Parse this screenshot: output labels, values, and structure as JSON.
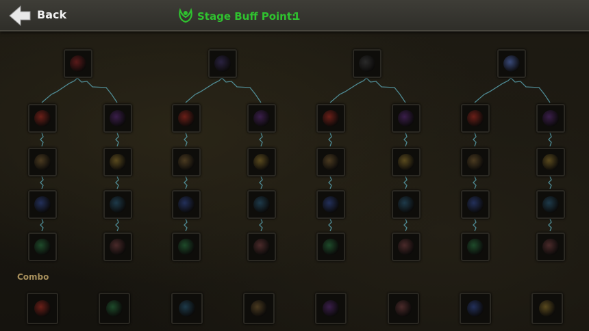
{
  "header": {
    "back_label": "Back",
    "buff_label": "Stage Buff Point:",
    "buff_value": "1",
    "buff_color": "#2fc22f"
  },
  "tree": {
    "columns": [
      {
        "root": {
          "icon": "demon-mask-icon",
          "color": "#5a1a1a"
        },
        "branches": [
          [
            "flame-orb-icon",
            "swirl-icon",
            "potion-icon",
            "red-rune-icon"
          ],
          [
            "claw-icon",
            "fire-fist-icon",
            "shadow-wing-icon",
            "dragon-head-icon"
          ]
        ]
      },
      {
        "root": {
          "icon": "void-orb-icon",
          "color": "#2a2240"
        },
        "branches": [
          [
            "blue-vortex-icon",
            "ice-slash-icon",
            "dark-knight-icon",
            "spear-bolt-icon"
          ],
          [
            "green-spiral-icon",
            "frost-orb-icon",
            "pink-blade-icon",
            "golden-burst-icon"
          ]
        ]
      },
      {
        "root": {
          "icon": "shield-crest-icon",
          "color": "#2a2a2a"
        },
        "branches": [
          [
            "fire-head-icon",
            "dagger-icon",
            "trident-icon",
            "spiked-mace-icon"
          ],
          [
            "green-rune-icon",
            "nature-claw-icon",
            "leaf-burst-icon",
            "blue-flower-icon"
          ]
        ]
      },
      {
        "root": {
          "icon": "blue-flame-icon",
          "color": "#3a4a7a"
        },
        "branches": [
          [
            "azure-flame-icon",
            "blue-wing-icon",
            "green-gust-icon",
            "violet-strike-icon"
          ],
          [
            "white-shield-icon",
            "water-swirl-icon",
            "golden-claw-icon",
            "sun-emblem-icon"
          ]
        ]
      }
    ]
  },
  "combo": {
    "title": "Combo",
    "items": [
      "fire-ring-icon",
      "golden-shield-icon",
      "gear-emblem-icon",
      "crimson-fist-icon",
      "green-crest-icon",
      "flame-pillar-icon",
      "lava-gate-icon",
      "war-banner-icon"
    ]
  },
  "colors": {
    "link": "#5fb0c0",
    "slot_border": "#2a2822",
    "combo_label": "#a8905c"
  }
}
